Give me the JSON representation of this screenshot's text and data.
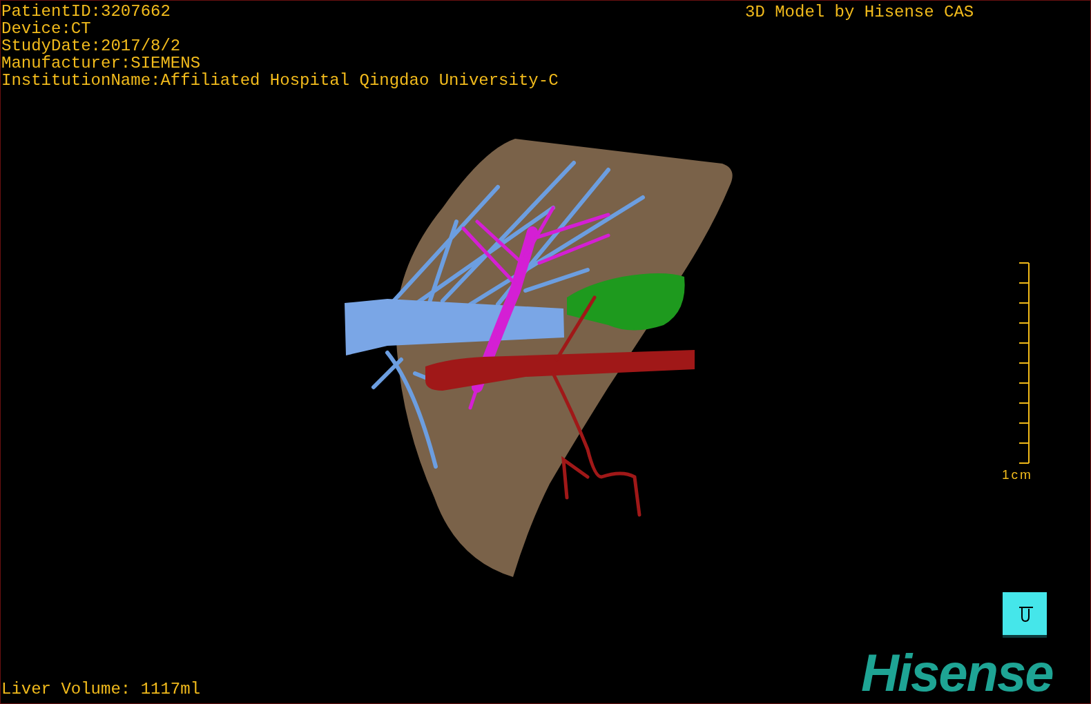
{
  "study_info": [
    "PatientID:3207662",
    "Device:CT",
    "StudyDate:2017/8/2",
    "Manufacturer:SIEMENS",
    "InstitutionName:Affiliated Hospital Qingdao University-C"
  ],
  "model_credit": "3D Model by Hisense CAS",
  "scale_bar": {
    "label": "1cm"
  },
  "liver_volume": "Liver Volume: 1117ml",
  "logo": "Hisense"
}
